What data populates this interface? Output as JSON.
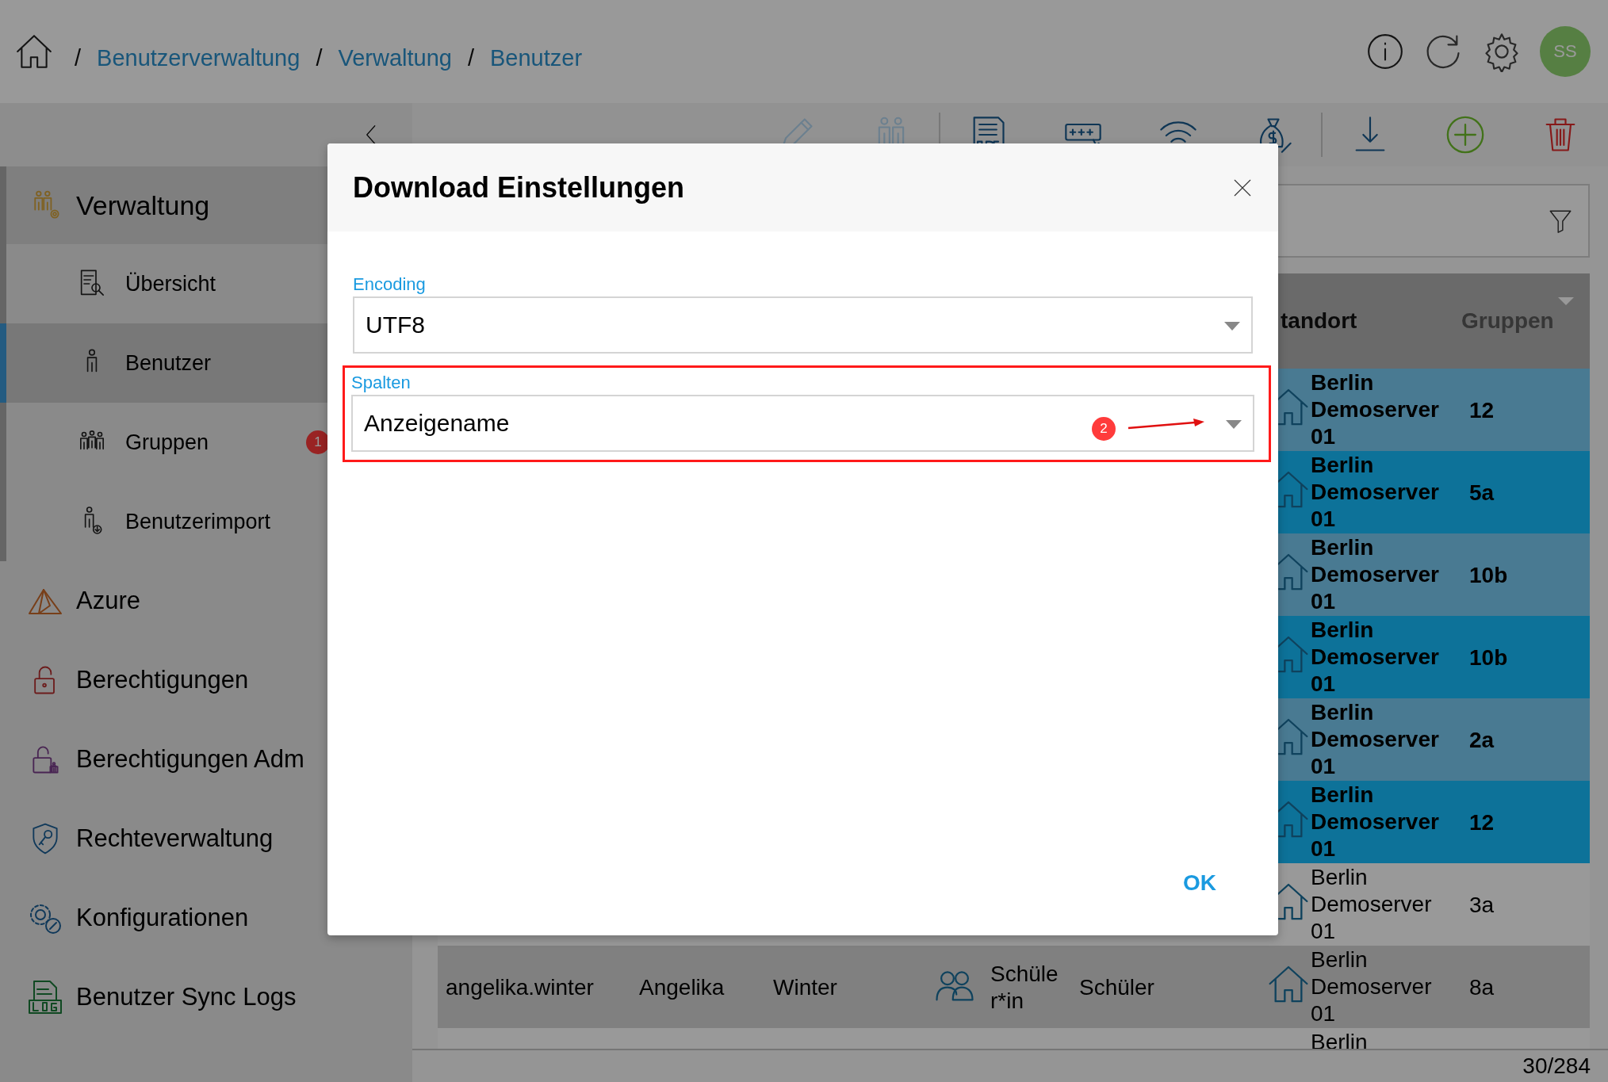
{
  "breadcrumb": {
    "separator": "/",
    "items": [
      "Benutzerverwaltung",
      "Verwaltung",
      "Benutzer"
    ]
  },
  "user": {
    "initials": "SS"
  },
  "toolbar": {
    "buttons": [
      {
        "disabled": true
      },
      {
        "disabled": true
      },
      {
        "disabled": false
      },
      {
        "disabled": false
      },
      {
        "disabled": false
      },
      {
        "disabled": false
      },
      {
        "disabled": false
      },
      {
        "disabled": false
      },
      {
        "disabled": false
      }
    ]
  },
  "sidebar": {
    "items": [
      {
        "label": "Verwaltung",
        "children": [
          {
            "label": "Übersicht",
            "selected": false
          },
          {
            "label": "Benutzer",
            "selected": true
          },
          {
            "label": "Gruppen",
            "selected": false,
            "annotation": "1"
          },
          {
            "label": "Benutzerimport",
            "selected": false
          }
        ]
      },
      {
        "label": "Azure"
      },
      {
        "label": "Berechtigungen"
      },
      {
        "label": "Berechtigungen Adm"
      },
      {
        "label": "Rechteverwaltung"
      },
      {
        "label": "Konfigurationen"
      },
      {
        "label": "Benutzer Sync Logs"
      }
    ]
  },
  "table": {
    "columns": [
      {
        "label": "tandort"
      },
      {
        "label": "Gruppen"
      }
    ],
    "rows": [
      {
        "selected": true,
        "hovered": false,
        "standort": "Berlin Demoserver 01",
        "gruppen": "12"
      },
      {
        "selected": true,
        "hovered": false,
        "standort": "Berlin Demoserver 01",
        "gruppen": "5a"
      },
      {
        "selected": true,
        "hovered": false,
        "standort": "Berlin Demoserver 01",
        "gruppen": "10b"
      },
      {
        "selected": true,
        "hovered": false,
        "standort": "Berlin Demoserver 01",
        "gruppen": "10b"
      },
      {
        "selected": true,
        "hovered": false,
        "standort": "Berlin Demoserver 01",
        "gruppen": "2a"
      },
      {
        "selected": true,
        "hovered": false,
        "standort": "Berlin Demoserver 01",
        "gruppen": "12"
      },
      {
        "selected": false,
        "hovered": false,
        "standort": "Berlin Demoserver 01",
        "gruppen": "3a"
      },
      {
        "selected": false,
        "hovered": true,
        "column_1": "angelika.winter",
        "column_2": "Angelika",
        "column_3": "Winter",
        "column_4": "Schüler*in",
        "column_5": "Schüler",
        "standort": "Berlin Demoserver 01",
        "gruppen": "8a"
      },
      {
        "selected": false,
        "hovered": false,
        "standort": "Berlin"
      }
    ]
  },
  "footer": {
    "count": "30/284"
  },
  "dialog": {
    "title": "Download Einstellungen",
    "fields": [
      {
        "label": "Encoding",
        "value": "UTF8",
        "highlighted": false
      },
      {
        "label": "Spalten",
        "value": "Anzeigename",
        "highlighted": true,
        "annotation": "2"
      }
    ],
    "ok": "OK"
  }
}
